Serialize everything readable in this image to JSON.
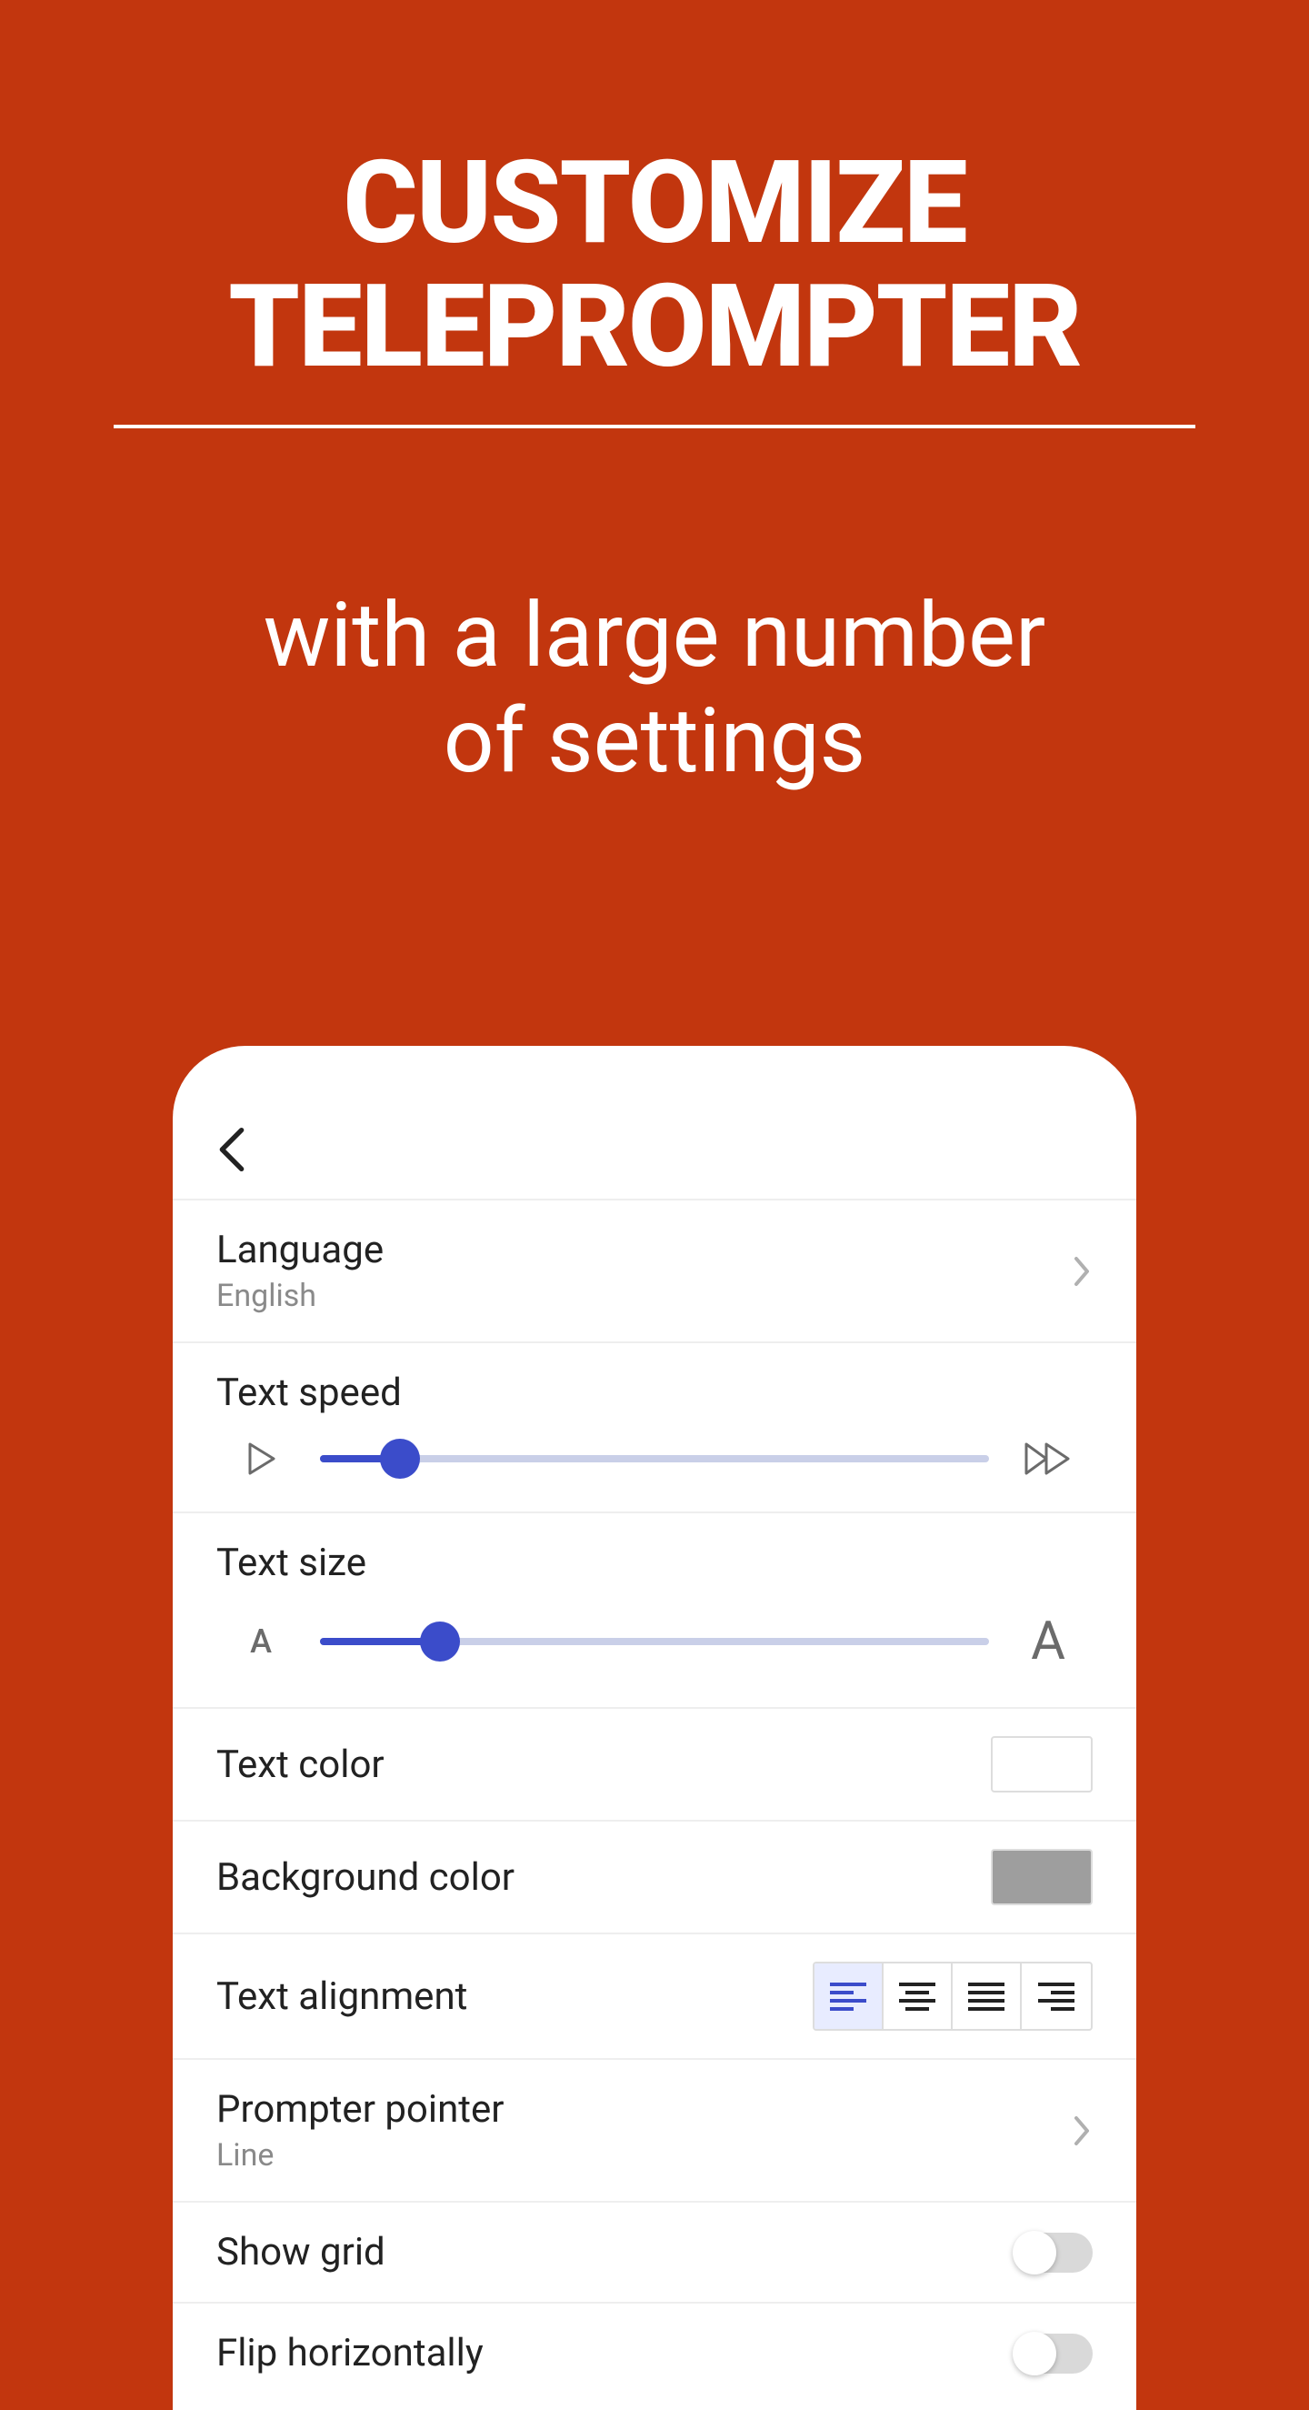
{
  "hero": {
    "title_line1": "CUSTOMIZE",
    "title_line2": "TELEPROMPTER",
    "sub_line1": "with a large number",
    "sub_line2": "of settings"
  },
  "settings": {
    "language": {
      "label": "Language",
      "value": "English"
    },
    "text_speed": {
      "label": "Text speed",
      "value_percent": 12
    },
    "text_size": {
      "label": "Text size",
      "value_percent": 18,
      "min_glyph": "A",
      "max_glyph": "A"
    },
    "text_color": {
      "label": "Text color",
      "swatch": "#ffffff"
    },
    "background_color": {
      "label": "Background color",
      "swatch": "#9e9e9e"
    },
    "text_alignment": {
      "label": "Text alignment",
      "selected_index": 0
    },
    "prompter_pointer": {
      "label": "Prompter pointer",
      "value": "Line"
    },
    "show_grid": {
      "label": "Show grid",
      "on": false
    },
    "flip_horizontally": {
      "label": "Flip horizontally",
      "on": false
    }
  }
}
